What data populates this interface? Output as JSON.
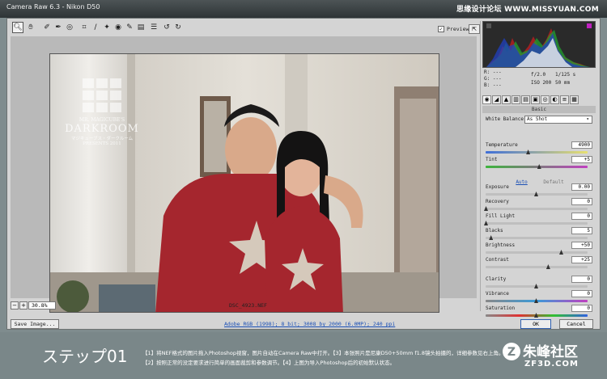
{
  "window": {
    "title": "Camera Raw 6.3  -  Nikon D50"
  },
  "watermark": "思缘设计论坛 WWW.MISSYUAN.COM",
  "toolbar": {
    "tools": [
      "zoom-tool",
      "hand-tool",
      "white-balance-tool",
      "color-sampler-tool",
      "targeted-adjustment-tool",
      "crop-tool",
      "straighten-tool",
      "spot-removal-tool",
      "red-eye-tool",
      "adjustment-brush-tool",
      "graduated-filter-tool",
      "open-preferences-tool",
      "rotate-ccw-tool",
      "rotate-cw-tool"
    ],
    "preview_label": "Preview",
    "preview_checked": true
  },
  "photo": {
    "logo_line1": "MR. MAGICUBE'S",
    "logo_line2": "DARKROOM",
    "logo_line3": "マジキューブス・ダークルーム",
    "logo_line4": "PRESENTS 2011"
  },
  "status": {
    "zoom": "30.8%",
    "filename": "DSC_4923.NEF"
  },
  "readout": {
    "r": "R: ---",
    "g": "G: ---",
    "b": "B: ---",
    "aperture": "f/2.0",
    "shutter": "1/125 s",
    "iso": "ISO 200",
    "focal": "50 mm"
  },
  "panel": {
    "section_title": "Basic",
    "white_balance_label": "White Balance:",
    "white_balance_value": "As Shot",
    "auto_label": "Auto",
    "default_label": "Default",
    "sliders": [
      {
        "label": "Temperature",
        "value": "4900",
        "pos": 0.42,
        "gradient": "temp"
      },
      {
        "label": "Tint",
        "value": "+5",
        "pos": 0.53,
        "gradient": "tint"
      },
      {
        "label": "Exposure",
        "value": "0.00",
        "pos": 0.5
      },
      {
        "label": "Recovery",
        "value": "0",
        "pos": 0.0
      },
      {
        "label": "Fill Light",
        "value": "0",
        "pos": 0.0
      },
      {
        "label": "Blacks",
        "value": "5",
        "pos": 0.05
      },
      {
        "label": "Brightness",
        "value": "+50",
        "pos": 0.75
      },
      {
        "label": "Contrast",
        "value": "+25",
        "pos": 0.62
      },
      {
        "label": "Clarity",
        "value": "0",
        "pos": 0.5
      },
      {
        "label": "Vibrance",
        "value": "0",
        "pos": 0.5,
        "gradient": "vib"
      },
      {
        "label": "Saturation",
        "value": "0",
        "pos": 0.5,
        "gradient": "sat"
      }
    ]
  },
  "bottom": {
    "save_label": "Save Image...",
    "workflow_text": "Adobe RGB (1998); 8 bit; 3008 by 2000 (6.0MP); 240 ppi",
    "ok_label": "OK",
    "cancel_label": "Cancel"
  },
  "footer": {
    "step_title": "ステップ01",
    "cap1": "【1】将NEF格式的图片拖入Photoshop视窗，图片自动在Camera Raw中打开。【3】本张照片是尼康D50+50mm f1.8镜头拍摄的，详细参数见右上角。",
    "cap2": "【2】按照正常的没定要求进行简单的画面裁剪和参数调节。【4】上图为导入Photoshop后的初始默认状态。",
    "logo_cn": "朱峰社区",
    "logo_en": "ZF3D.COM"
  },
  "colors": {
    "accent": "#1a4fb5",
    "shirt": "#a5262e",
    "wall": "#d9d4cc"
  }
}
